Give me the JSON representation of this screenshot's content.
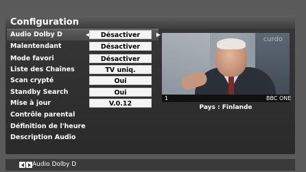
{
  "title": "Configuration",
  "menu": [
    {
      "label": "Audio Dolby D",
      "value": "Désactiver"
    },
    {
      "label": "Malentendant",
      "value": "Désactiver"
    },
    {
      "label": "Mode favori",
      "value": "Désactiver"
    },
    {
      "label": "Liste des Chaînes",
      "value": "TV uniq."
    },
    {
      "label": "Scan crypté",
      "value": "Oui"
    },
    {
      "label": "Standby Search",
      "value": "Oui"
    },
    {
      "label": "Mise à jour",
      "value": "V.0.12"
    },
    {
      "label": "Contrôle parental"
    },
    {
      "label": "Définition de l'heure"
    },
    {
      "label": "Description Audio"
    }
  ],
  "selected_index": 0,
  "arrows": {
    "left": "◀",
    "right": "▶"
  },
  "preview": {
    "watermark": "curdo",
    "channel_number": "1",
    "channel_name": "BBC ONE",
    "country": "Pays : Finlande"
  },
  "footer": {
    "hint": "Audio Dolby D"
  },
  "colors": {
    "panel": "#2f2f2f",
    "value_box": "#f4f4f4",
    "text": "#ffffff"
  }
}
